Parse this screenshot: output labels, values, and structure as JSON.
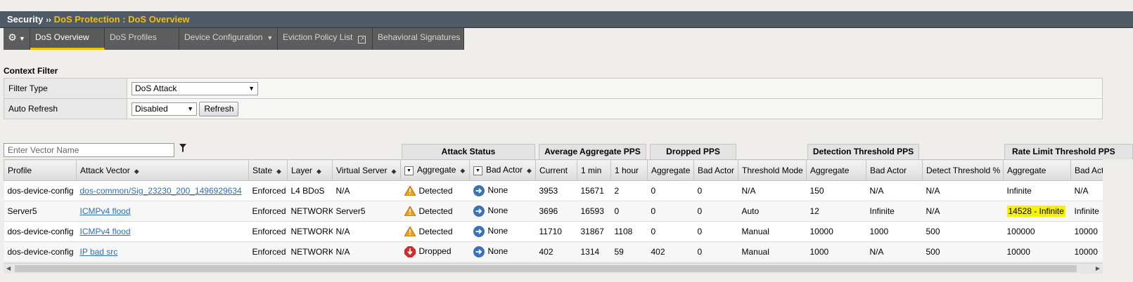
{
  "breadcrumb": {
    "root": "Security",
    "separator": "››",
    "current": "DoS Protection : DoS Overview"
  },
  "tabs": [
    {
      "label": "DoS Overview",
      "active": true
    },
    {
      "label": "DoS Profiles"
    },
    {
      "label": "Device Configuration",
      "has_dropdown": true
    },
    {
      "label": "Eviction Policy List",
      "external_icon": true
    },
    {
      "label": "Behavioral Signatures"
    }
  ],
  "context_filter": {
    "title": "Context Filter",
    "filter_type_label": "Filter Type",
    "filter_type_value": "DoS Attack",
    "auto_refresh_label": "Auto Refresh",
    "auto_refresh_value": "Disabled",
    "refresh_button": "Refresh"
  },
  "search": {
    "placeholder": "Enter Vector Name"
  },
  "column_groups": {
    "attack_status": "Attack Status",
    "avg_aggregate_pps": "Average Aggregate PPS",
    "dropped_pps": "Dropped PPS",
    "detection_threshold_pps": "Detection Threshold PPS",
    "rate_limit_threshold_pps": "Rate Limit Threshold PPS"
  },
  "columns": [
    "Profile",
    "Attack Vector",
    "State",
    "Layer",
    "Virtual Server",
    "Aggregate",
    "Bad Actor",
    "Current",
    "1 min",
    "1 hour",
    "Aggregate",
    "Bad Actor",
    "Threshold Mode",
    "Aggregate",
    "Bad Actor",
    "Detect Threshold %",
    "Aggregate",
    "Bad Actor"
  ],
  "rows": [
    {
      "profile": "dos-device-config",
      "vector": "dos-common/Sig_23230_200_1496929634",
      "state": "Enforced",
      "layer": "L4 BDoS",
      "vs": "N/A",
      "agg_status": "Detected",
      "agg_icon": "warning",
      "bad_status": "None",
      "current": "3953",
      "min1": "15671",
      "hour1": "2",
      "drop_agg": "0",
      "drop_bad": "0",
      "mode": "N/A",
      "det_agg": "150",
      "det_bad": "N/A",
      "det_pct": "N/A",
      "rl_agg": "Infinite",
      "rl_bad": "N/A"
    },
    {
      "profile": "Server5",
      "vector": "ICMPv4 flood",
      "state": "Enforced",
      "layer": "NETWORK",
      "vs": "Server5",
      "agg_status": "Detected",
      "agg_icon": "warning",
      "bad_status": "None",
      "current": "3696",
      "min1": "16593",
      "hour1": "0",
      "drop_agg": "0",
      "drop_bad": "0",
      "mode": "Auto",
      "det_agg": "12",
      "det_bad": "Infinite",
      "det_pct": "N/A",
      "rl_agg": "14528 - Infinite",
      "rl_bad": "Infinite",
      "highlight": true
    },
    {
      "profile": "dos-device-config",
      "vector": "ICMPv4 flood",
      "state": "Enforced",
      "layer": "NETWORK",
      "vs": "N/A",
      "agg_status": "Detected",
      "agg_icon": "warning",
      "bad_status": "None",
      "current": "11710",
      "min1": "31867",
      "hour1": "1108",
      "drop_agg": "0",
      "drop_bad": "0",
      "mode": "Manual",
      "det_agg": "10000",
      "det_bad": "1000",
      "det_pct": "500",
      "rl_agg": "100000",
      "rl_bad": "10000"
    },
    {
      "profile": "dos-device-config",
      "vector": "IP bad src",
      "state": "Enforced",
      "layer": "NETWORK",
      "vs": "N/A",
      "agg_status": "Dropped",
      "agg_icon": "stop",
      "bad_status": "None",
      "current": "402",
      "min1": "1314",
      "hour1": "59",
      "drop_agg": "402",
      "drop_bad": "0",
      "mode": "Manual",
      "det_agg": "1000",
      "det_bad": "N/A",
      "det_pct": "500",
      "rl_agg": "10000",
      "rl_bad": "10000"
    }
  ]
}
